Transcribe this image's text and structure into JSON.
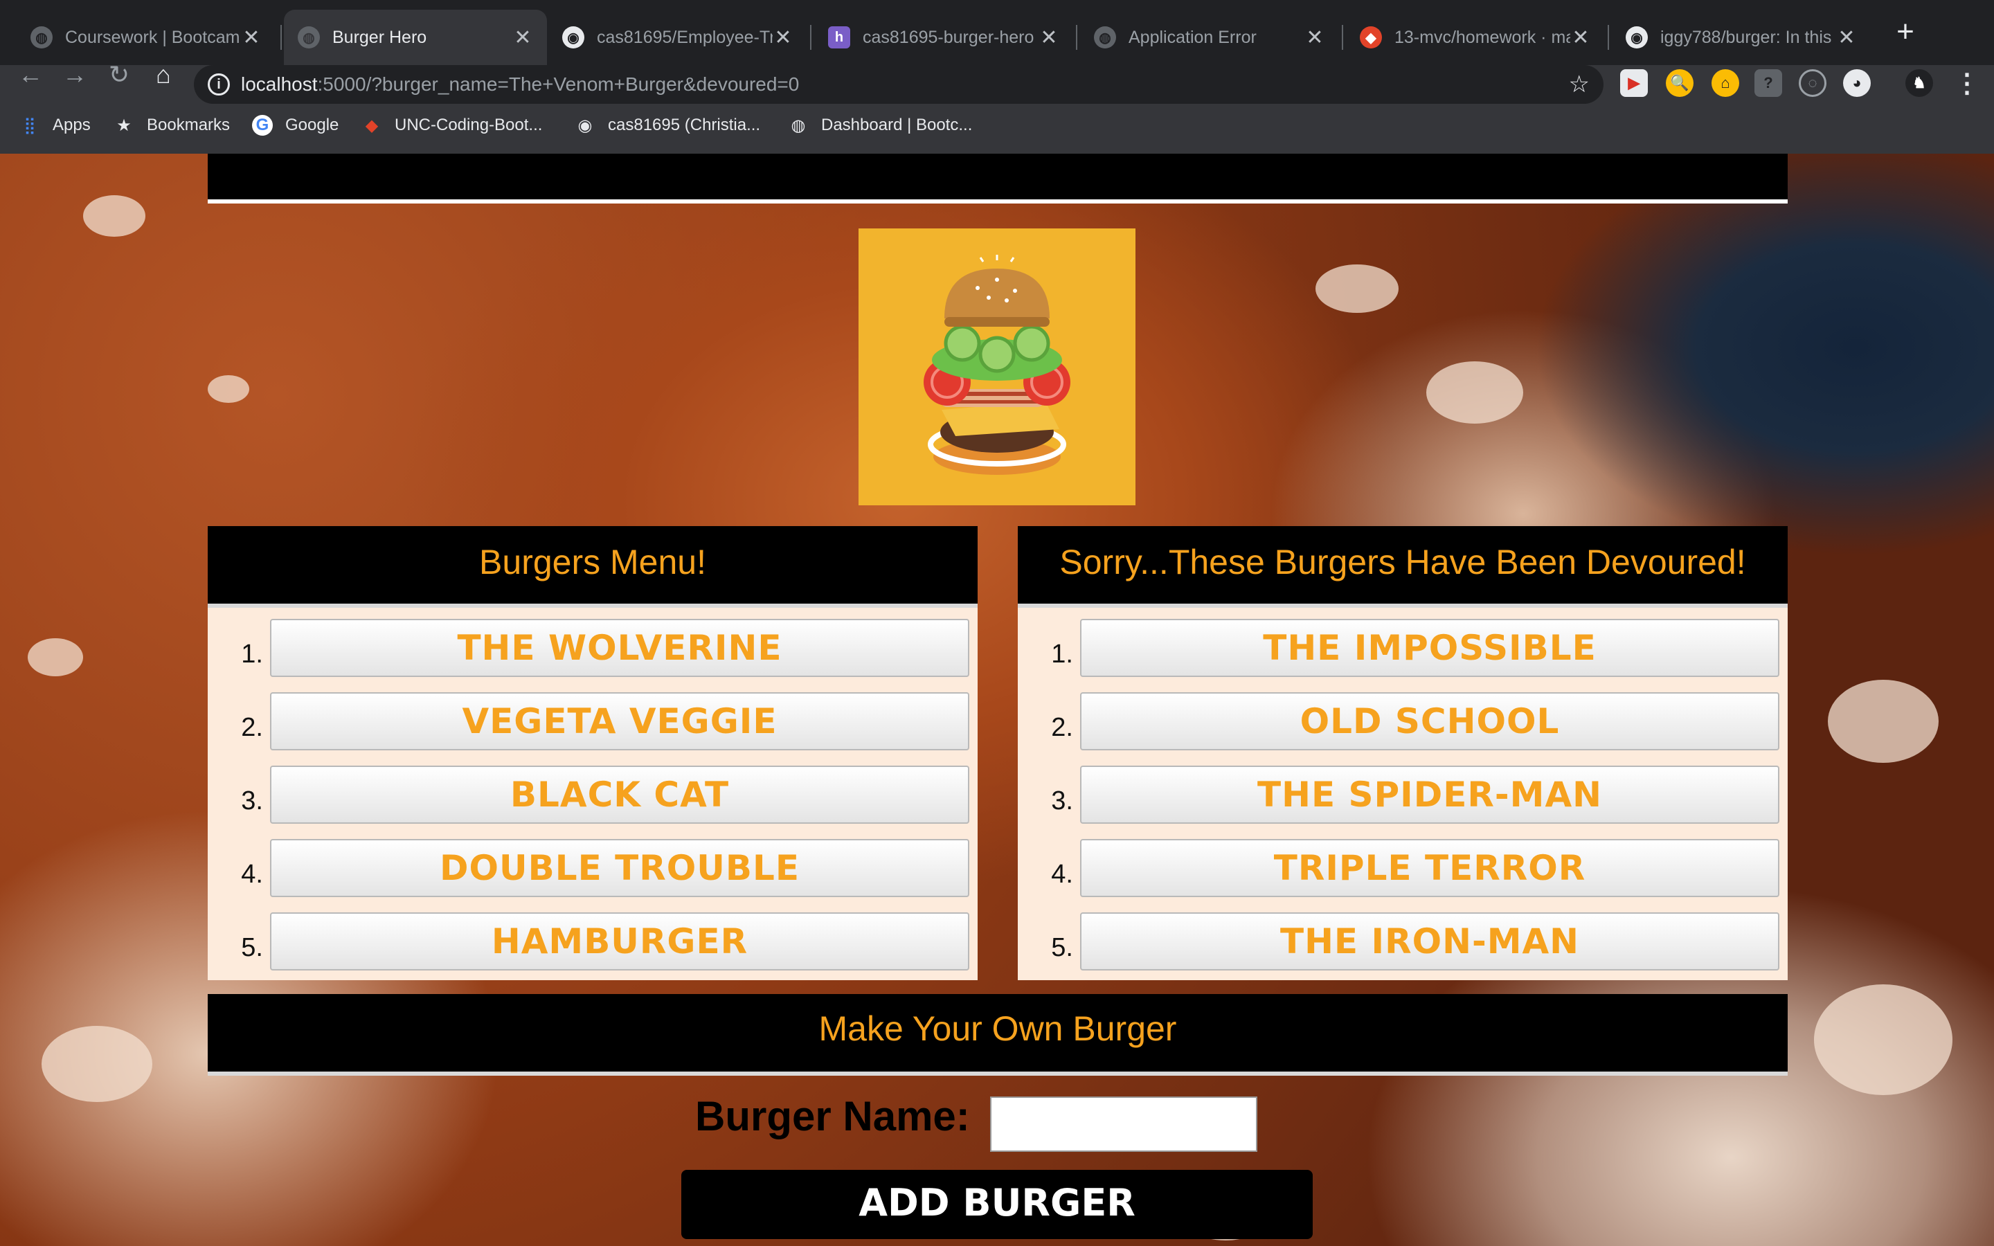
{
  "browser": {
    "tabs": [
      {
        "title": "Coursework | Bootcamp",
        "active": false
      },
      {
        "title": "Burger Hero",
        "active": true
      },
      {
        "title": "cas81695/Employee-Tr",
        "active": false
      },
      {
        "title": "cas81695-burger-hero",
        "active": false
      },
      {
        "title": "Application Error",
        "active": false
      },
      {
        "title": "13-mvc/homework · ma",
        "active": false
      },
      {
        "title": "iggy788/burger: In this",
        "active": false
      }
    ],
    "url_host": "localhost",
    "url_rest": ":5000/?burger_name=The+Venom+Burger&devoured=0",
    "bookmarks": [
      {
        "label": "Apps"
      },
      {
        "label": "Bookmarks"
      },
      {
        "label": "Google"
      },
      {
        "label": "UNC-Coding-Boot..."
      },
      {
        "label": "cas81695 (Christia..."
      },
      {
        "label": "Dashboard | Bootc..."
      }
    ]
  },
  "page": {
    "menu": {
      "title": "Burgers Menu!",
      "items": [
        "The Wolverine",
        "Vegeta Veggie",
        "Black Cat",
        "Double Trouble",
        "Hamburger"
      ]
    },
    "devoured": {
      "title": "Sorry...These Burgers Have Been Devoured!",
      "items": [
        "The Impossible",
        "Old School",
        "The Spider-Man",
        "Triple Terror",
        "The Iron-Man"
      ]
    },
    "numbers": [
      "1.",
      "2.",
      "3.",
      "4.",
      "5."
    ],
    "form": {
      "heading": "Make Your Own Burger",
      "label": "Burger Name:",
      "value": "",
      "button": "Add Burger"
    }
  },
  "colors": {
    "accent": "#f6a21e",
    "logo_bg": "#f2b42d",
    "panel_bg": "#fdebdc"
  }
}
